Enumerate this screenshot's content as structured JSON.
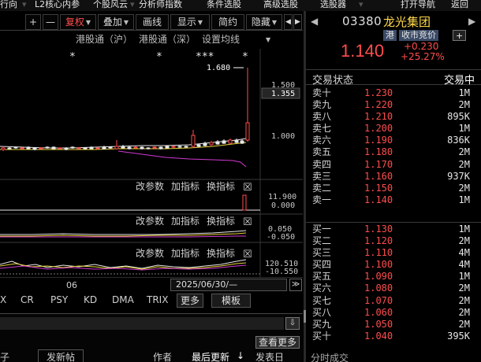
{
  "menu": {
    "items": [
      "行向",
      "L2核心内参",
      "个股风云",
      "分析师指数",
      "条件选股",
      "高级选股",
      "选股器",
      "打开导航",
      "返回"
    ],
    "carets": [
      "▾",
      "▾",
      "▾"
    ]
  },
  "toolbar": {
    "plus": "+",
    "minus": "—",
    "fuquan": "复权",
    "diejia": "叠加",
    "huaxian": "画线",
    "xianshi": "显示",
    "jianyue": "简约",
    "yincang": "隐藏",
    "prev": "◀",
    "next": "▶"
  },
  "chart": {
    "hk_hu": "港股通（沪）",
    "hk_shen": "港股通（深）",
    "ma_settings": "设置均线",
    "markers": [
      "*",
      "*",
      "***",
      "*"
    ],
    "price_axis": [
      "1.500",
      "1.355",
      "1.000"
    ],
    "high_label": "1.680",
    "sub1": {
      "params": "改参数",
      "add": "加指标",
      "swap": "换指标",
      "close": "☒",
      "axis": [
        "11.900",
        "0.000"
      ]
    },
    "sub2": {
      "params": "改参数",
      "add": "加指标",
      "swap": "换指标",
      "close": "☒",
      "axis": [
        "0.050",
        "-0.050"
      ]
    },
    "sub3": {
      "params": "改参数",
      "add": "加指标",
      "swap": "换指标",
      "close": "☒",
      "axis": [
        "120.510",
        "-10.550"
      ]
    }
  },
  "chart_data": {
    "type": "candlestick",
    "annotations": [
      "1.680"
    ],
    "y_axis_labels": [
      "1.500",
      "1.355",
      "1.000"
    ],
    "last_price": 1.14,
    "high": 1.68
  },
  "datebar": {
    "label06": "06",
    "selected": "2025/06/30/—",
    "next": "≫"
  },
  "indicators": {
    "items": [
      "X",
      "CR",
      "PSY",
      "KD",
      "DMA",
      "TRIX"
    ],
    "more": "更多",
    "template": "模板"
  },
  "lowpanel": {
    "download": "⇩",
    "view_more": "查看更多",
    "tabs": [
      "子",
      "发新帖",
      "作者",
      "最后更新",
      "发表日"
    ],
    "sort_arrow": "↓"
  },
  "quote": {
    "prev": "◀",
    "next": "▶",
    "code": "03380",
    "name": "龙光集团",
    "badge_hk": "港",
    "badge_auction": "收市竞价",
    "plus_box": "+",
    "price": "1.140",
    "change": "+0.230",
    "pct": "+25.27%",
    "status_label": "交易状态",
    "status_value": "交易中",
    "asks": [
      {
        "label": "卖十",
        "price": "1.230",
        "vol": "1M"
      },
      {
        "label": "卖九",
        "price": "1.220",
        "vol": "2M"
      },
      {
        "label": "卖八",
        "price": "1.210",
        "vol": "895K"
      },
      {
        "label": "卖七",
        "price": "1.200",
        "vol": "1M"
      },
      {
        "label": "卖六",
        "price": "1.190",
        "vol": "836K"
      },
      {
        "label": "卖五",
        "price": "1.180",
        "vol": "2M"
      },
      {
        "label": "卖四",
        "price": "1.170",
        "vol": "2M"
      },
      {
        "label": "卖三",
        "price": "1.160",
        "vol": "937K"
      },
      {
        "label": "卖二",
        "price": "1.150",
        "vol": "2M"
      },
      {
        "label": "卖一",
        "price": "1.140",
        "vol": "1M"
      }
    ],
    "bids": [
      {
        "label": "买一",
        "price": "1.130",
        "vol": "1M"
      },
      {
        "label": "买二",
        "price": "1.120",
        "vol": "2M"
      },
      {
        "label": "买三",
        "price": "1.110",
        "vol": "4M"
      },
      {
        "label": "买四",
        "price": "1.100",
        "vol": "4M"
      },
      {
        "label": "买五",
        "price": "1.090",
        "vol": "1M"
      },
      {
        "label": "买六",
        "price": "1.080",
        "vol": "2M"
      },
      {
        "label": "买七",
        "price": "1.070",
        "vol": "2M"
      },
      {
        "label": "买八",
        "price": "1.060",
        "vol": "2M"
      },
      {
        "label": "买九",
        "price": "1.050",
        "vol": "2M"
      },
      {
        "label": "买十",
        "price": "1.040",
        "vol": "395K"
      }
    ],
    "footer": "分时成交"
  },
  "colors": {
    "up": "#ff4d4d",
    "name": "#ffd84a",
    "ma_white": "#e8e8e8",
    "ma_yellow": "#e8d23a",
    "ma_magenta": "#d23ad2"
  }
}
